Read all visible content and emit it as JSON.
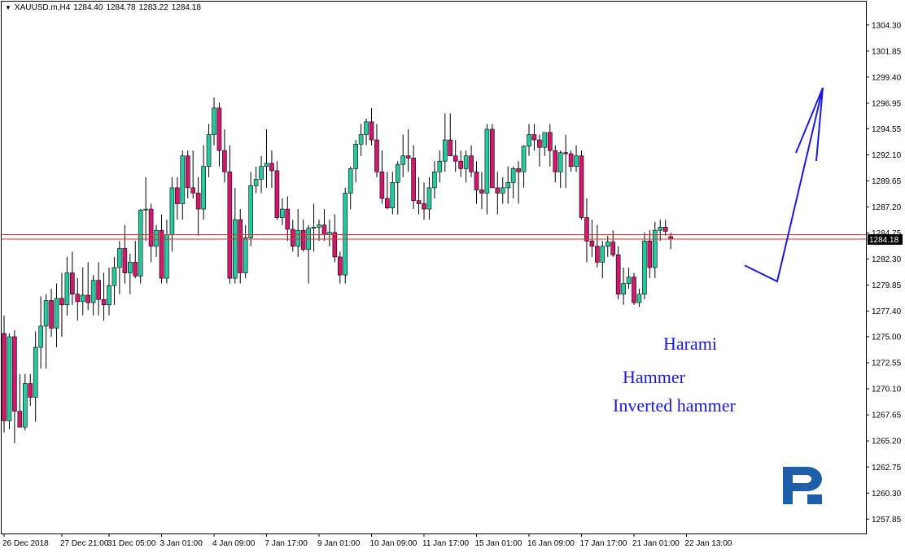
{
  "header": {
    "symbol": "XAUUSD.m,H4",
    "open": "1284.40",
    "high": "1284.78",
    "low": "1283.22",
    "close": "1284.18"
  },
  "annotations": {
    "harami": "Harami",
    "hammer": "Hammer",
    "inverted_hammer": "Inverted hammer"
  },
  "colors": {
    "bull": "#26c9a0",
    "bear": "#d0186e",
    "wick": "#000000",
    "current_line": "#e03030",
    "price_box": "#000000",
    "forecast_arrow": "#1a1adc",
    "logo": "#1d5fa8"
  },
  "logo_icon": "roboforex-r-logo-icon",
  "chart_data": {
    "type": "candlestick",
    "symbol": "XAUUSD.m",
    "timeframe": "H4",
    "ylim": [
      1256.5,
      1306.5
    ],
    "y_ticks": [
      "1304.30",
      "1301.85",
      "1299.40",
      "1296.95",
      "1294.55",
      "1292.10",
      "1289.65",
      "1287.20",
      "1284.75",
      "1282.30",
      "1279.85",
      "1277.40",
      "1275.00",
      "1272.55",
      "1270.10",
      "1267.65",
      "1265.20",
      "1262.75",
      "1260.30",
      "1257.85"
    ],
    "x_ticks": [
      {
        "label": "26 Dec 2018",
        "index": 0
      },
      {
        "label": "27 Dec 21:00",
        "index": 11
      },
      {
        "label": "31 Dec 05:00",
        "index": 20
      },
      {
        "label": "3 Jan 01:00",
        "index": 30
      },
      {
        "label": "4 Jan 09:00",
        "index": 40
      },
      {
        "label": "7 Jan 17:00",
        "index": 50
      },
      {
        "label": "9 Jan 01:00",
        "index": 60
      },
      {
        "label": "10 Jan 09:00",
        "index": 70
      },
      {
        "label": "11 Jan 17:00",
        "index": 80
      },
      {
        "label": "15 Jan 01:00",
        "index": 90
      },
      {
        "label": "16 Jan 09:00",
        "index": 100
      },
      {
        "label": "17 Jan 17:00",
        "index": 110
      },
      {
        "label": "21 Jan 01:00",
        "index": 120
      },
      {
        "label": "22 Jan 13:00",
        "index": 130
      }
    ],
    "current_price": "1284.18",
    "current_price_value": 1284.18,
    "ask_line_value": 1284.6,
    "candles": [
      [
        1275.3,
        1277.0,
        1266.0,
        1267.1
      ],
      [
        1267.1,
        1275.3,
        1266.3,
        1275.0
      ],
      [
        1275.0,
        1275.6,
        1265.0,
        1268.0
      ],
      [
        1268.0,
        1271.5,
        1266.5,
        1266.5
      ],
      [
        1266.5,
        1271.5,
        1266.2,
        1270.6
      ],
      [
        1270.6,
        1271.5,
        1268.5,
        1269.3
      ],
      [
        1269.3,
        1275.5,
        1267.0,
        1274.0
      ],
      [
        1274.0,
        1278.8,
        1272.0,
        1276.0
      ],
      [
        1276.0,
        1279.0,
        1272.0,
        1278.4
      ],
      [
        1278.4,
        1279.5,
        1275.0,
        1275.8
      ],
      [
        1275.8,
        1280.0,
        1274.0,
        1278.6
      ],
      [
        1278.6,
        1281.0,
        1275.0,
        1278.0
      ],
      [
        1278.0,
        1282.5,
        1277.0,
        1281.0
      ],
      [
        1281.0,
        1283.0,
        1278.0,
        1279.0
      ],
      [
        1279.0,
        1280.5,
        1276.5,
        1278.3
      ],
      [
        1278.3,
        1281.5,
        1277.0,
        1278.9
      ],
      [
        1278.9,
        1282.0,
        1277.5,
        1278.2
      ],
      [
        1278.2,
        1280.8,
        1277.0,
        1280.3
      ],
      [
        1280.3,
        1282.0,
        1277.0,
        1278.5
      ],
      [
        1278.5,
        1281.0,
        1276.5,
        1278.0
      ],
      [
        1278.0,
        1281.5,
        1277.0,
        1279.8
      ],
      [
        1279.8,
        1282.5,
        1278.0,
        1281.5
      ],
      [
        1281.5,
        1284.0,
        1279.0,
        1283.3
      ],
      [
        1283.3,
        1285.5,
        1280.0,
        1281.0
      ],
      [
        1281.0,
        1282.8,
        1279.0,
        1282.0
      ],
      [
        1282.0,
        1284.0,
        1280.5,
        1280.7
      ],
      [
        1280.7,
        1287.0,
        1280.0,
        1286.9
      ],
      [
        1286.9,
        1290.0,
        1284.0,
        1287.0
      ],
      [
        1287.0,
        1287.5,
        1282.0,
        1283.5
      ],
      [
        1283.5,
        1285.5,
        1282.5,
        1285.0
      ],
      [
        1285.0,
        1286.5,
        1280.0,
        1280.5
      ],
      [
        1280.5,
        1286.0,
        1280.0,
        1284.6
      ],
      [
        1284.6,
        1290.0,
        1283.0,
        1289.0
      ],
      [
        1289.0,
        1290.0,
        1286.0,
        1287.5
      ],
      [
        1287.5,
        1292.5,
        1286.0,
        1292.0
      ],
      [
        1292.0,
        1292.5,
        1288.0,
        1289.0
      ],
      [
        1289.0,
        1292.5,
        1288.0,
        1288.5
      ],
      [
        1288.5,
        1290.0,
        1284.5,
        1287.0
      ],
      [
        1287.0,
        1293.0,
        1286.0,
        1291.0
      ],
      [
        1291.0,
        1295.0,
        1290.0,
        1294.0
      ],
      [
        1294.0,
        1297.5,
        1293.0,
        1296.5
      ],
      [
        1296.5,
        1297.0,
        1291.0,
        1292.5
      ],
      [
        1292.5,
        1294.5,
        1289.5,
        1290.5
      ],
      [
        1290.5,
        1293.0,
        1280.0,
        1280.5
      ],
      [
        1280.5,
        1289.0,
        1280.0,
        1286.0
      ],
      [
        1286.0,
        1287.0,
        1280.0,
        1281.0
      ],
      [
        1281.0,
        1285.5,
        1280.5,
        1284.3
      ],
      [
        1284.3,
        1290.5,
        1283.5,
        1289.2
      ],
      [
        1289.2,
        1291.0,
        1288.5,
        1289.8
      ],
      [
        1289.8,
        1292.0,
        1288.5,
        1291.0
      ],
      [
        1291.0,
        1294.5,
        1289.0,
        1291.3
      ],
      [
        1291.3,
        1292.5,
        1289.0,
        1290.6
      ],
      [
        1290.6,
        1291.5,
        1286.0,
        1286.2
      ],
      [
        1286.2,
        1288.0,
        1285.5,
        1287.0
      ],
      [
        1287.0,
        1288.2,
        1284.0,
        1285.1
      ],
      [
        1285.1,
        1286.0,
        1283.0,
        1283.5
      ],
      [
        1283.5,
        1287.0,
        1282.5,
        1285.0
      ],
      [
        1285.0,
        1286.0,
        1283.0,
        1283.2
      ],
      [
        1283.2,
        1285.5,
        1280.0,
        1285.2
      ],
      [
        1285.2,
        1287.5,
        1283.0,
        1285.3
      ],
      [
        1285.3,
        1286.0,
        1284.0,
        1285.5
      ],
      [
        1285.5,
        1287.0,
        1284.0,
        1284.6
      ],
      [
        1284.6,
        1286.0,
        1283.5,
        1284.8
      ],
      [
        1284.8,
        1286.5,
        1282.0,
        1282.5
      ],
      [
        1282.5,
        1283.0,
        1280.0,
        1280.8
      ],
      [
        1280.8,
        1289.0,
        1280.0,
        1288.5
      ],
      [
        1288.5,
        1291.0,
        1287.0,
        1290.8
      ],
      [
        1290.8,
        1293.5,
        1289.5,
        1293.1
      ],
      [
        1293.1,
        1295.0,
        1292.0,
        1294.0
      ],
      [
        1294.0,
        1295.5,
        1293.0,
        1295.2
      ],
      [
        1295.2,
        1296.5,
        1293.0,
        1293.5
      ],
      [
        1293.5,
        1295.0,
        1290.0,
        1290.5
      ],
      [
        1290.5,
        1292.5,
        1287.5,
        1288.0
      ],
      [
        1288.0,
        1290.5,
        1287.0,
        1287.1
      ],
      [
        1287.1,
        1290.5,
        1286.5,
        1289.5
      ],
      [
        1289.5,
        1291.5,
        1286.5,
        1291.2
      ],
      [
        1291.2,
        1294.0,
        1290.0,
        1292.0
      ],
      [
        1292.0,
        1294.5,
        1290.5,
        1291.8
      ],
      [
        1291.8,
        1293.0,
        1287.0,
        1287.8
      ],
      [
        1287.8,
        1290.0,
        1286.5,
        1287.5
      ],
      [
        1287.5,
        1289.5,
        1286.0,
        1287.0
      ],
      [
        1287.0,
        1290.0,
        1286.0,
        1289.0
      ],
      [
        1289.0,
        1291.5,
        1288.0,
        1290.5
      ],
      [
        1290.5,
        1292.5,
        1289.5,
        1291.5
      ],
      [
        1291.5,
        1296.0,
        1290.5,
        1293.5
      ],
      [
        1293.5,
        1296.0,
        1292.0,
        1292.0
      ],
      [
        1292.0,
        1293.5,
        1290.5,
        1291.5
      ],
      [
        1291.5,
        1292.5,
        1290.0,
        1290.8
      ],
      [
        1290.8,
        1292.5,
        1289.5,
        1292.0
      ],
      [
        1292.0,
        1293.0,
        1290.0,
        1290.5
      ],
      [
        1290.5,
        1291.5,
        1287.5,
        1288.8
      ],
      [
        1288.8,
        1290.5,
        1287.0,
        1288.5
      ],
      [
        1288.5,
        1295.0,
        1286.5,
        1294.5
      ],
      [
        1294.5,
        1295.0,
        1289.0,
        1289.0
      ],
      [
        1289.0,
        1290.5,
        1286.5,
        1288.5
      ],
      [
        1288.5,
        1290.0,
        1287.5,
        1289.0
      ],
      [
        1289.0,
        1291.0,
        1287.5,
        1289.5
      ],
      [
        1289.5,
        1291.0,
        1288.0,
        1290.8
      ],
      [
        1290.8,
        1291.5,
        1287.5,
        1290.5
      ],
      [
        1290.5,
        1293.0,
        1289.0,
        1292.9
      ],
      [
        1292.9,
        1295.0,
        1292.0,
        1294.0
      ],
      [
        1294.0,
        1295.0,
        1292.5,
        1293.5
      ],
      [
        1293.5,
        1294.0,
        1291.0,
        1292.8
      ],
      [
        1292.8,
        1294.0,
        1292.0,
        1294.2
      ],
      [
        1294.2,
        1295.0,
        1291.0,
        1292.5
      ],
      [
        1292.5,
        1293.0,
        1289.5,
        1290.5
      ],
      [
        1290.5,
        1292.5,
        1289.0,
        1292.3
      ],
      [
        1292.3,
        1294.0,
        1289.0,
        1292.2
      ],
      [
        1292.2,
        1292.5,
        1290.5,
        1291.0
      ],
      [
        1291.0,
        1293.0,
        1290.5,
        1292.0
      ],
      [
        1292.0,
        1292.5,
        1286.0,
        1286.2
      ],
      [
        1286.2,
        1288.0,
        1282.0,
        1284.0
      ],
      [
        1284.0,
        1286.0,
        1282.5,
        1283.5
      ],
      [
        1283.5,
        1285.5,
        1281.5,
        1282.0
      ],
      [
        1282.0,
        1284.0,
        1280.5,
        1283.5
      ],
      [
        1283.5,
        1284.5,
        1282.5,
        1283.9
      ],
      [
        1283.9,
        1285.0,
        1282.5,
        1282.7
      ],
      [
        1282.7,
        1283.5,
        1278.5,
        1279.0
      ],
      [
        1279.0,
        1281.5,
        1278.0,
        1280.0
      ],
      [
        1280.0,
        1281.5,
        1279.5,
        1280.6
      ],
      [
        1280.6,
        1281.0,
        1278.0,
        1278.2
      ],
      [
        1278.2,
        1279.5,
        1277.8,
        1279.0
      ],
      [
        1279.0,
        1284.8,
        1278.5,
        1284.0
      ],
      [
        1284.0,
        1285.0,
        1280.5,
        1281.5
      ],
      [
        1281.5,
        1285.8,
        1280.5,
        1285.0
      ],
      [
        1285.0,
        1286.0,
        1284.0,
        1285.3
      ],
      [
        1285.3,
        1286.0,
        1284.5,
        1284.9
      ],
      [
        1284.4,
        1284.78,
        1283.22,
        1284.18
      ]
    ],
    "forecast_arrow": [
      [
        0,
        1281.7
      ],
      [
        1,
        1280.2
      ],
      [
        2,
        1298.4
      ]
    ],
    "annotations": [
      "Harami",
      "Hammer",
      "Inverted hammer"
    ]
  }
}
